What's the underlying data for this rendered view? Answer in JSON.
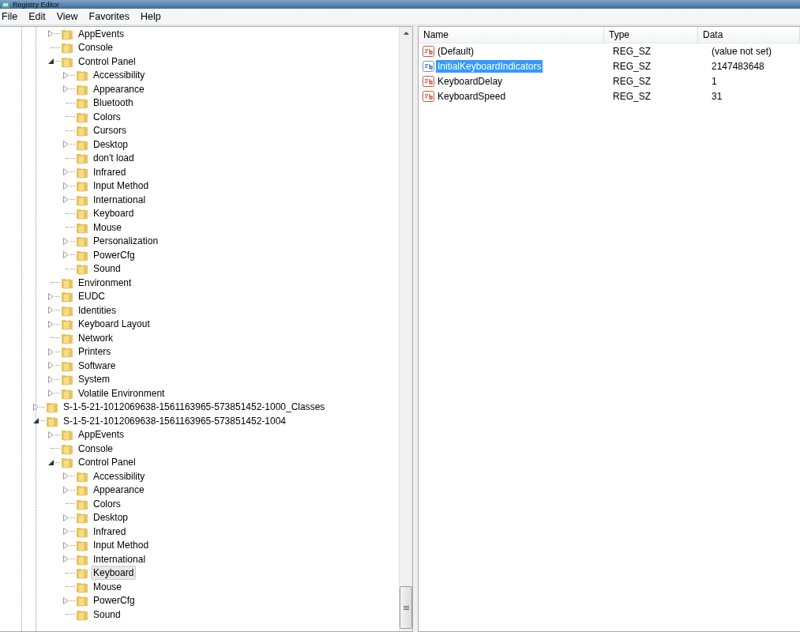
{
  "window": {
    "title": "Registry Editor"
  },
  "menu": [
    "File",
    "Edit",
    "View",
    "Favorites",
    "Help"
  ],
  "tree": [
    {
      "children": [
        {
          "label": "AppEvents",
          "expandable": true,
          "expanded": false,
          "selected": false
        },
        {
          "label": "Console",
          "expandable": false,
          "expanded": false,
          "selected": false
        },
        {
          "label": "Control Panel",
          "expandable": true,
          "expanded": true,
          "selected": false,
          "children": [
            {
              "label": "Accessibility",
              "expandable": true,
              "expanded": false,
              "selected": false
            },
            {
              "label": "Appearance",
              "expandable": true,
              "expanded": false,
              "selected": false
            },
            {
              "label": "Bluetooth",
              "expandable": false,
              "expanded": false,
              "selected": false
            },
            {
              "label": "Colors",
              "expandable": false,
              "expanded": false,
              "selected": false
            },
            {
              "label": "Cursors",
              "expandable": false,
              "expanded": false,
              "selected": false
            },
            {
              "label": "Desktop",
              "expandable": true,
              "expanded": false,
              "selected": false
            },
            {
              "label": "don't load",
              "expandable": false,
              "expanded": false,
              "selected": false
            },
            {
              "label": "Infrared",
              "expandable": true,
              "expanded": false,
              "selected": false
            },
            {
              "label": "Input Method",
              "expandable": true,
              "expanded": false,
              "selected": false
            },
            {
              "label": "International",
              "expandable": true,
              "expanded": false,
              "selected": false
            },
            {
              "label": "Keyboard",
              "expandable": false,
              "expanded": false,
              "selected": false
            },
            {
              "label": "Mouse",
              "expandable": false,
              "expanded": false,
              "selected": false
            },
            {
              "label": "Personalization",
              "expandable": true,
              "expanded": false,
              "selected": false
            },
            {
              "label": "PowerCfg",
              "expandable": true,
              "expanded": false,
              "selected": false
            },
            {
              "label": "Sound",
              "expandable": false,
              "expanded": false,
              "selected": false
            }
          ]
        },
        {
          "label": "Environment",
          "expandable": false,
          "expanded": false,
          "selected": false
        },
        {
          "label": "EUDC",
          "expandable": true,
          "expanded": false,
          "selected": false
        },
        {
          "label": "Identities",
          "expandable": true,
          "expanded": false,
          "selected": false
        },
        {
          "label": "Keyboard Layout",
          "expandable": true,
          "expanded": false,
          "selected": false
        },
        {
          "label": "Network",
          "expandable": false,
          "expanded": false,
          "selected": false
        },
        {
          "label": "Printers",
          "expandable": true,
          "expanded": false,
          "selected": false
        },
        {
          "label": "Software",
          "expandable": true,
          "expanded": false,
          "selected": false
        },
        {
          "label": "System",
          "expandable": true,
          "expanded": false,
          "selected": false
        },
        {
          "label": "Volatile Environment",
          "expandable": true,
          "expanded": false,
          "selected": false
        }
      ]
    },
    {
      "label": "S-1-5-21-1012069638-1561163965-573851452-1000_Classes",
      "expandable": true,
      "expanded": false,
      "selected": false
    },
    {
      "label": "S-1-5-21-1012069638-1561163965-573851452-1004",
      "expandable": true,
      "expanded": true,
      "selected": false,
      "children": [
        {
          "label": "AppEvents",
          "expandable": true,
          "expanded": false,
          "selected": false
        },
        {
          "label": "Console",
          "expandable": false,
          "expanded": false,
          "selected": false
        },
        {
          "label": "Control Panel",
          "expandable": true,
          "expanded": true,
          "selected": false,
          "children": [
            {
              "label": "Accessibility",
              "expandable": true,
              "expanded": false,
              "selected": false
            },
            {
              "label": "Appearance",
              "expandable": true,
              "expanded": false,
              "selected": false
            },
            {
              "label": "Colors",
              "expandable": false,
              "expanded": false,
              "selected": false
            },
            {
              "label": "Desktop",
              "expandable": true,
              "expanded": false,
              "selected": false
            },
            {
              "label": "Infrared",
              "expandable": true,
              "expanded": false,
              "selected": false
            },
            {
              "label": "Input Method",
              "expandable": true,
              "expanded": false,
              "selected": false
            },
            {
              "label": "International",
              "expandable": true,
              "expanded": false,
              "selected": false
            },
            {
              "label": "Keyboard",
              "expandable": false,
              "expanded": false,
              "selected": true
            },
            {
              "label": "Mouse",
              "expandable": false,
              "expanded": false,
              "selected": false
            },
            {
              "label": "PowerCfg",
              "expandable": true,
              "expanded": false,
              "selected": false
            },
            {
              "label": "Sound",
              "expandable": false,
              "expanded": false,
              "selected": false
            }
          ]
        }
      ]
    }
  ],
  "values": {
    "columns": [
      "Name",
      "Type",
      "Data"
    ],
    "rows": [
      {
        "name": "(Default)",
        "type": "REG_SZ",
        "data": "(value not set)",
        "selected": false
      },
      {
        "name": "InitialKeyboardIndicators",
        "type": "REG_SZ",
        "data": "2147483648",
        "selected": true
      },
      {
        "name": "KeyboardDelay",
        "type": "REG_SZ",
        "data": "1",
        "selected": false
      },
      {
        "name": "KeyboardSpeed",
        "type": "REG_SZ",
        "data": "31",
        "selected": false
      }
    ]
  }
}
